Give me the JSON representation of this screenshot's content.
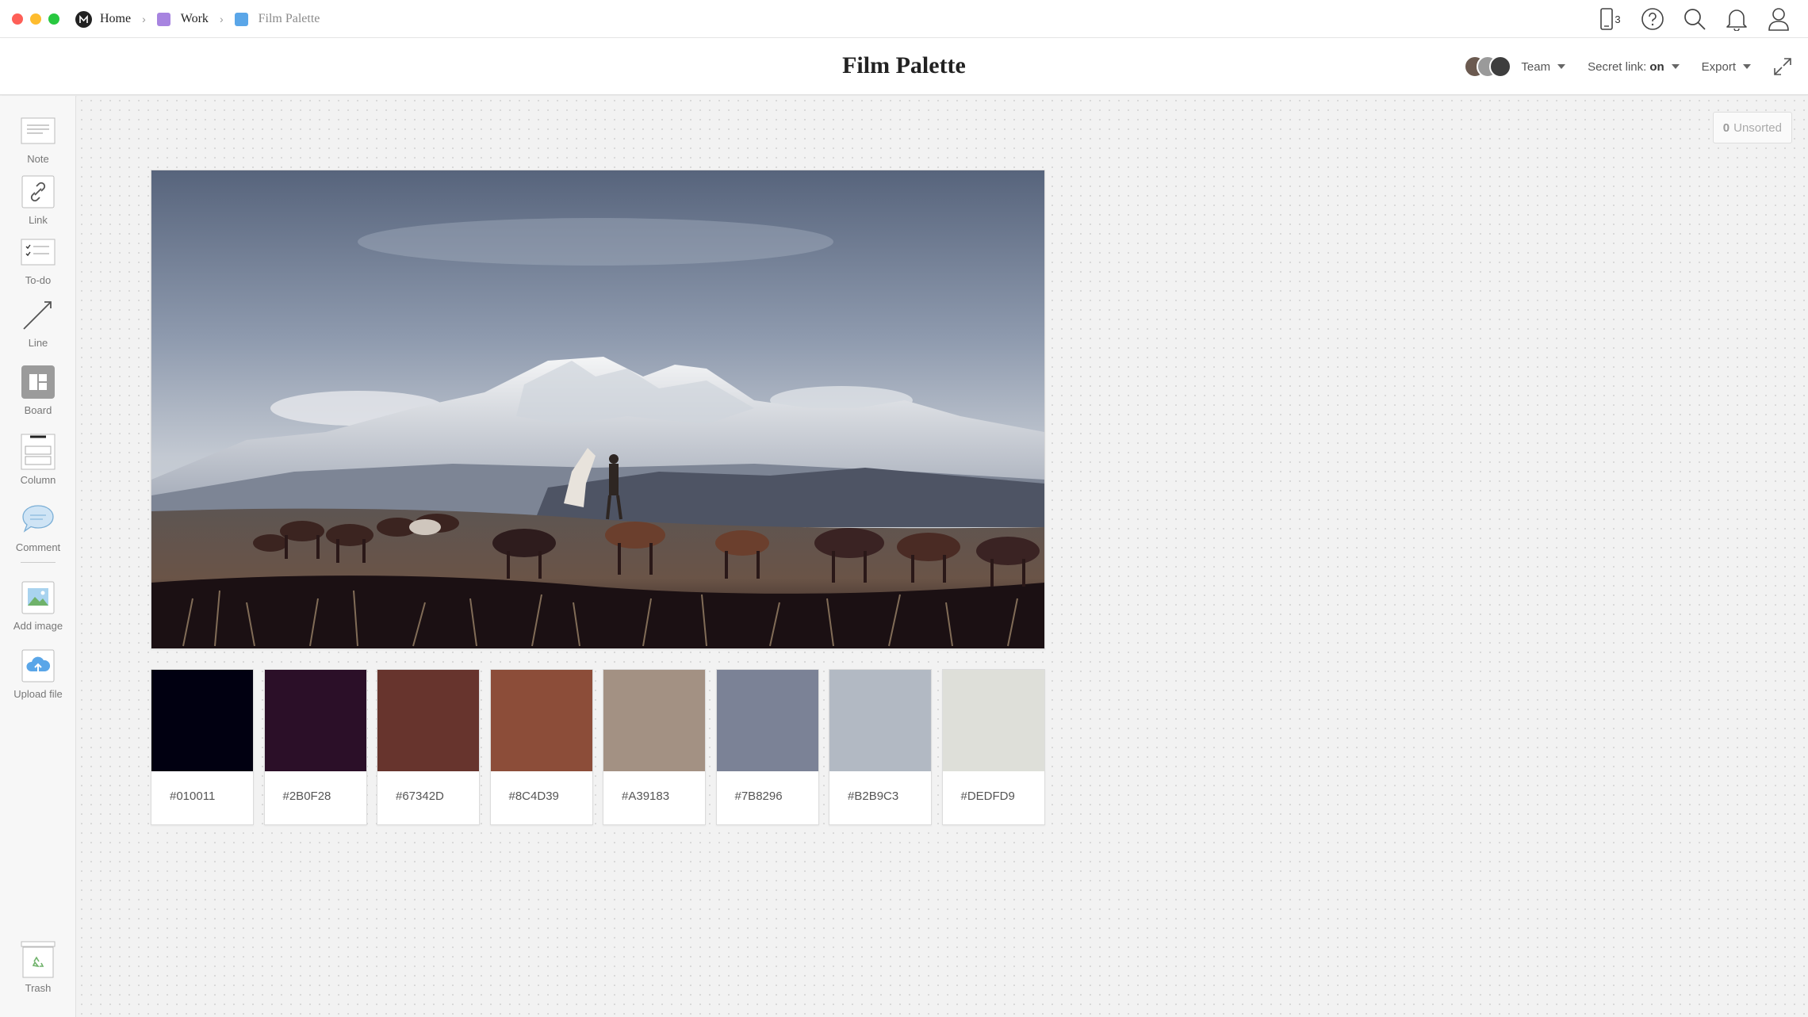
{
  "titlebar": {
    "breadcrumbs": [
      {
        "label": "Home",
        "color": "#222222"
      },
      {
        "label": "Work",
        "color": "#a784e0"
      },
      {
        "label": "Film Palette",
        "color": "#5aa6e8"
      }
    ],
    "device_count": "3",
    "icons": [
      "mobile-device-icon",
      "help-icon",
      "search-icon",
      "bell-icon",
      "user-icon"
    ]
  },
  "header": {
    "title": "Film Palette",
    "team_label": "Team",
    "secret_link_label": "Secret link:",
    "secret_link_value": "on",
    "export_label": "Export"
  },
  "sidebar": {
    "tools": [
      {
        "label": "Note",
        "icon": "note-icon"
      },
      {
        "label": "Link",
        "icon": "link-icon"
      },
      {
        "label": "To-do",
        "icon": "todo-icon"
      },
      {
        "label": "Line",
        "icon": "line-icon"
      },
      {
        "label": "Board",
        "icon": "board-icon"
      },
      {
        "label": "Column",
        "icon": "column-icon"
      },
      {
        "label": "Comment",
        "icon": "comment-icon"
      },
      {
        "label": "Add image",
        "icon": "image-icon"
      },
      {
        "label": "Upload file",
        "icon": "upload-icon"
      }
    ],
    "trash_label": "Trash"
  },
  "canvas": {
    "unsorted_count": "0",
    "unsorted_label": "Unsorted",
    "swatches": [
      {
        "hex": "#010011"
      },
      {
        "hex": "#2B0F28"
      },
      {
        "hex": "#67342D"
      },
      {
        "hex": "#8C4D39"
      },
      {
        "hex": "#A39183"
      },
      {
        "hex": "#7B8296"
      },
      {
        "hex": "#B2B9C3"
      },
      {
        "hex": "#DEDFD9"
      }
    ]
  }
}
